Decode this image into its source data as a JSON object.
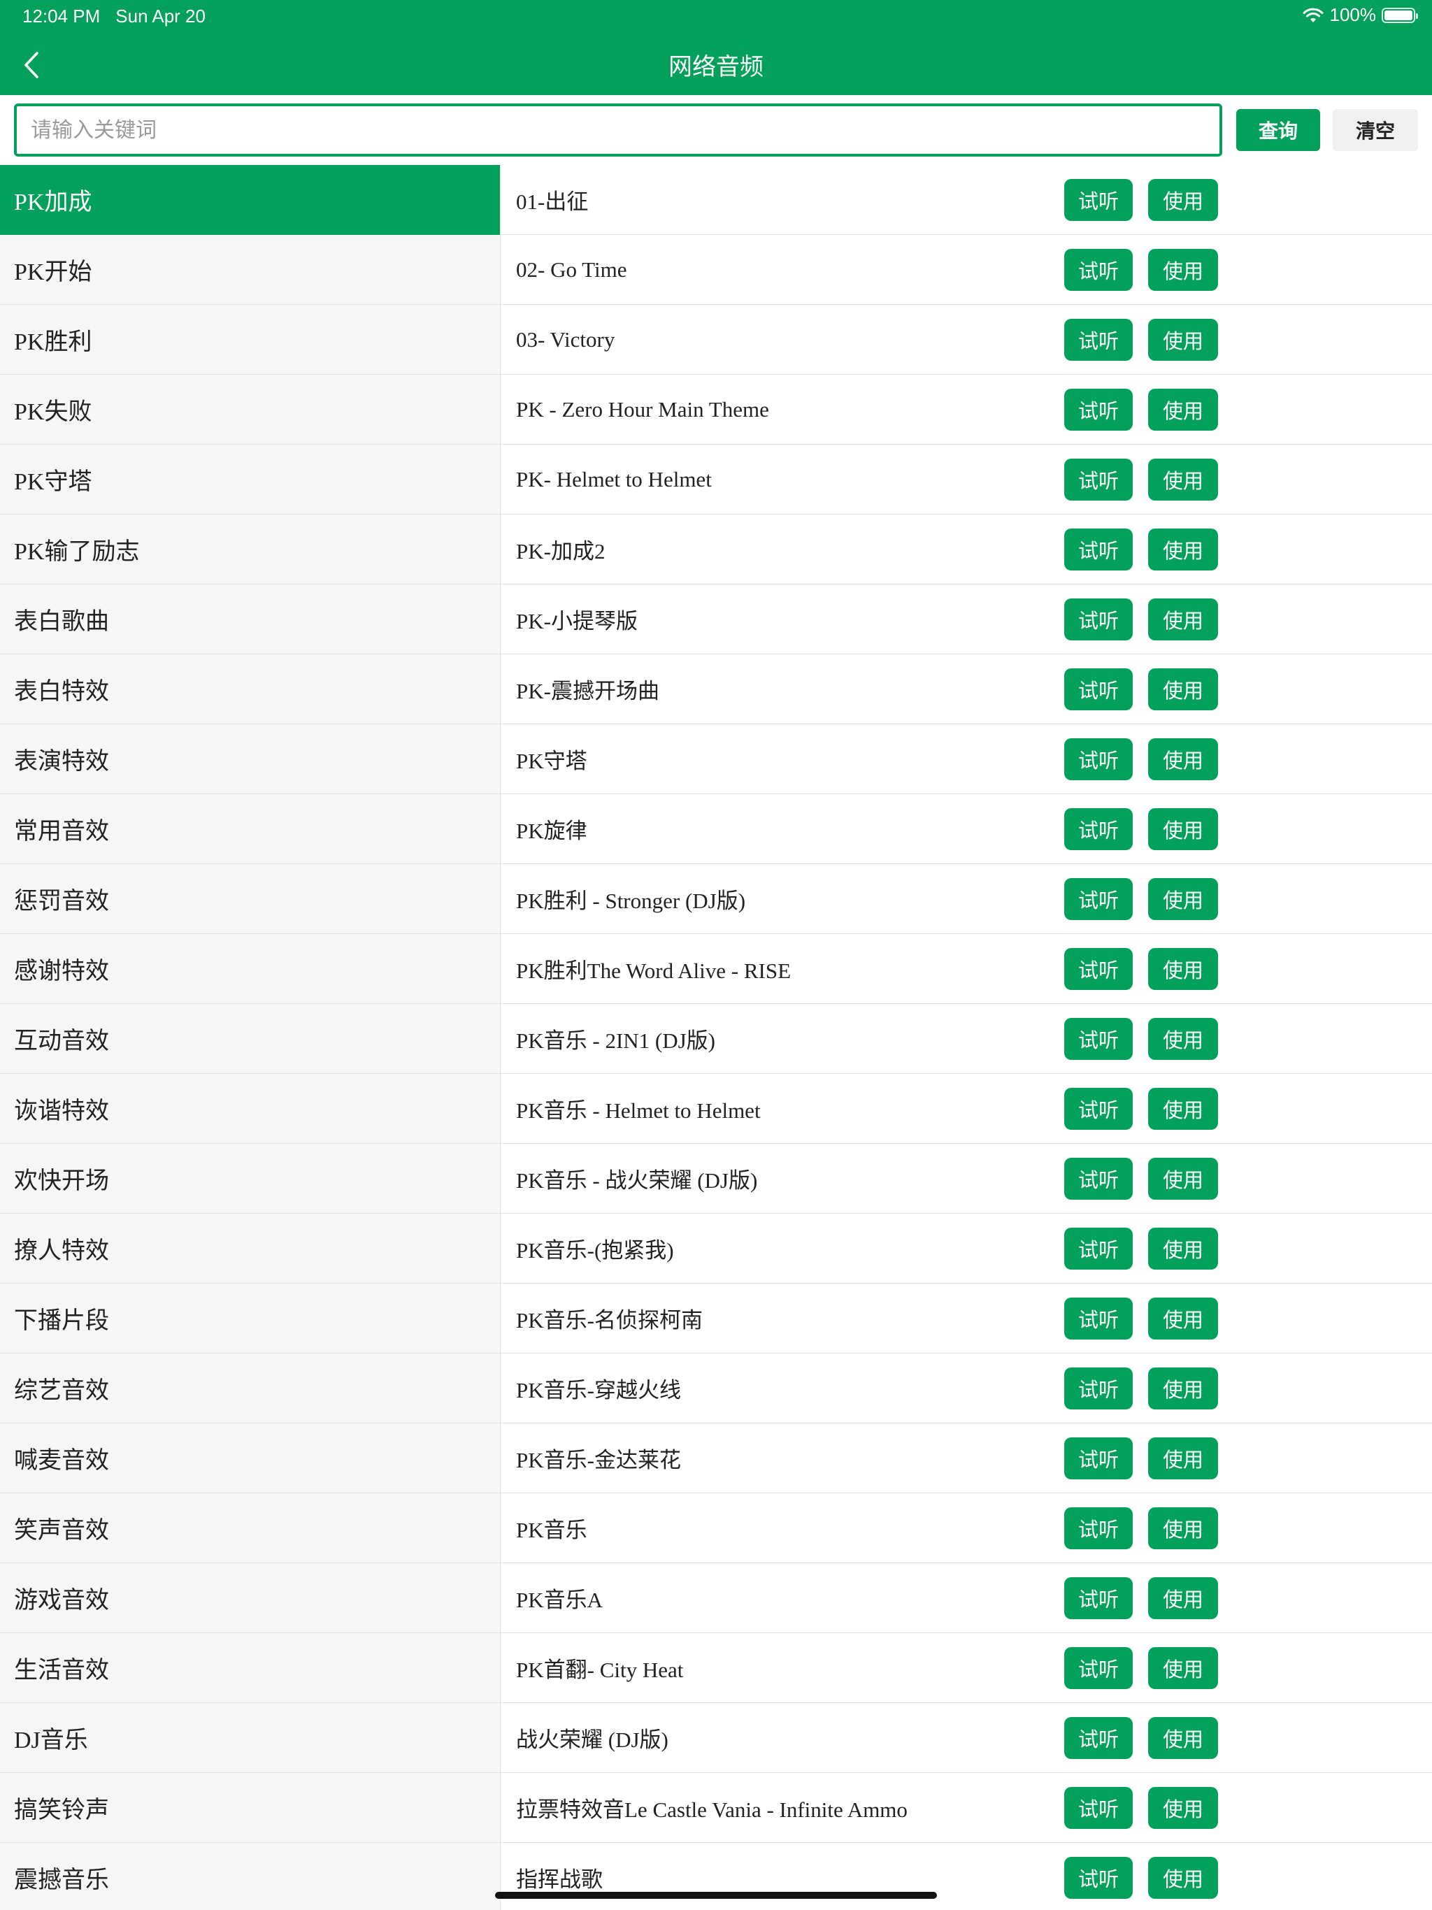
{
  "status_bar": {
    "time": "12:04 PM",
    "date": "Sun Apr 20",
    "battery": "100%"
  },
  "header": {
    "title": "网络音频"
  },
  "search": {
    "placeholder": "请输入关键词",
    "value": "",
    "query_label": "查询",
    "clear_label": "清空"
  },
  "categories": [
    {
      "label": "PK加成",
      "active": true
    },
    {
      "label": "PK开始"
    },
    {
      "label": "PK胜利"
    },
    {
      "label": "PK失败"
    },
    {
      "label": "PK守塔"
    },
    {
      "label": "PK输了励志"
    },
    {
      "label": "表白歌曲"
    },
    {
      "label": "表白特效"
    },
    {
      "label": "表演特效"
    },
    {
      "label": "常用音效"
    },
    {
      "label": "惩罚音效"
    },
    {
      "label": "感谢特效"
    },
    {
      "label": "互动音效"
    },
    {
      "label": "诙谐特效"
    },
    {
      "label": "欢快开场"
    },
    {
      "label": "撩人特效"
    },
    {
      "label": "下播片段"
    },
    {
      "label": "综艺音效"
    },
    {
      "label": "喊麦音效"
    },
    {
      "label": "笑声音效"
    },
    {
      "label": "游戏音效"
    },
    {
      "label": "生活音效"
    },
    {
      "label": "DJ音乐"
    },
    {
      "label": "搞笑铃声"
    },
    {
      "label": "震撼音乐"
    }
  ],
  "audio_items": [
    {
      "name": "01-出征"
    },
    {
      "name": "02- Go Time"
    },
    {
      "name": "03- Victory"
    },
    {
      "name": "PK - Zero Hour Main Theme"
    },
    {
      "name": "PK- Helmet to Helmet"
    },
    {
      "name": "PK-加成2"
    },
    {
      "name": "PK-小提琴版"
    },
    {
      "name": "PK-震撼开场曲"
    },
    {
      "name": "PK守塔"
    },
    {
      "name": "PK旋律"
    },
    {
      "name": "PK胜利 - Stronger (DJ版)"
    },
    {
      "name": "PK胜利The Word Alive - RISE"
    },
    {
      "name": "PK音乐 - 2IN1 (DJ版)"
    },
    {
      "name": "PK音乐 - Helmet to Helmet"
    },
    {
      "name": "PK音乐 - 战火荣耀 (DJ版)"
    },
    {
      "name": "PK音乐-(抱紧我)"
    },
    {
      "name": "PK音乐-名侦探柯南"
    },
    {
      "name": "PK音乐-穿越火线"
    },
    {
      "name": "PK音乐-金达莱花"
    },
    {
      "name": "PK音乐"
    },
    {
      "name": "PK音乐A"
    },
    {
      "name": "PK首翻- City Heat"
    },
    {
      "name": "战火荣耀 (DJ版)"
    },
    {
      "name": "拉票特效音Le Castle Vania - Infinite Ammo"
    },
    {
      "name": "指挥战歌"
    }
  ],
  "row_buttons": {
    "listen_label": "试听",
    "use_label": "使用"
  },
  "colors": {
    "accent": "#02a05a",
    "list_bg": "#f6f6f6",
    "divider": "#e2e2e2"
  },
  "icons": {
    "back": "chevron-left-icon",
    "wifi": "wifi-icon",
    "battery": "battery-icon"
  }
}
